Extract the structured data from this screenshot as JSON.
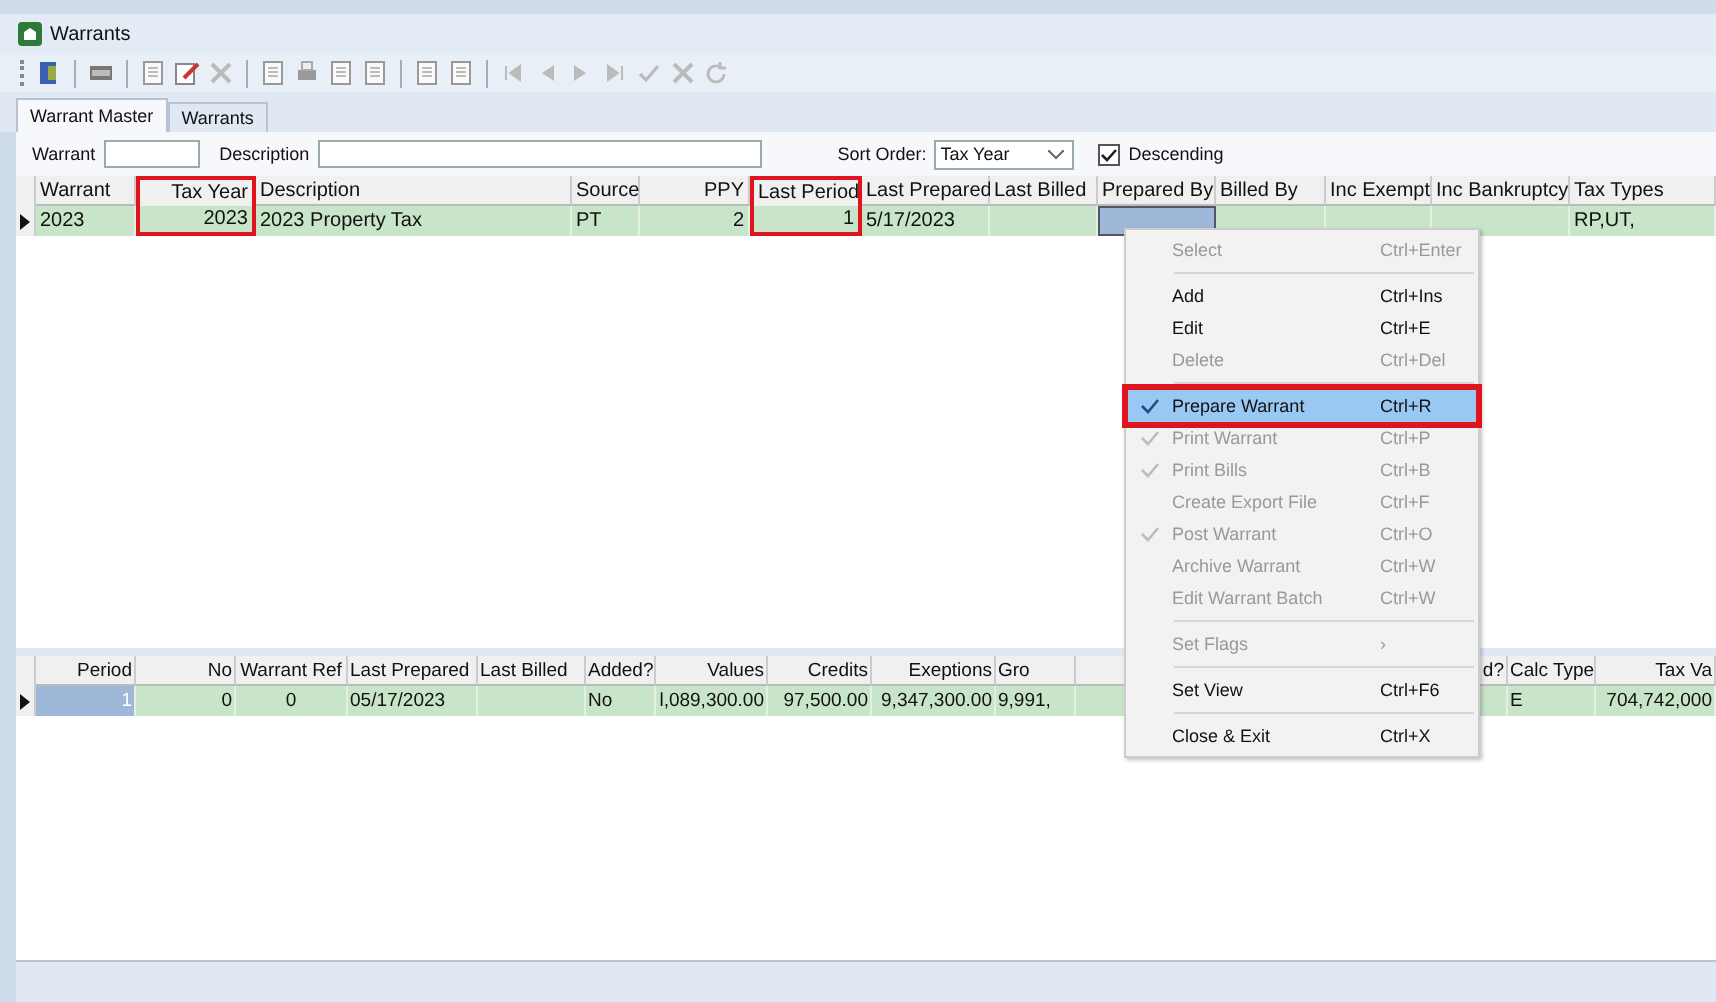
{
  "window": {
    "title": "Warrants"
  },
  "tabs": [
    {
      "label": "Warrant Master",
      "selected": true
    },
    {
      "label": "Warrants",
      "selected": false
    }
  ],
  "filter": {
    "warrant_label": "Warrant",
    "description_label": "Description",
    "sort_label": "Sort Order:",
    "sort_value": "Tax Year",
    "descending": {
      "label": "Descending",
      "checked": true
    }
  },
  "master_grid": {
    "columns": [
      {
        "label": "Warrant",
        "highlighted": false
      },
      {
        "label": "Tax Year",
        "highlighted": true
      },
      {
        "label": "Description",
        "highlighted": false
      },
      {
        "label": "Source",
        "highlighted": false
      },
      {
        "label": "PPY",
        "highlighted": false
      },
      {
        "label": "Last Period",
        "highlighted": true
      },
      {
        "label": "Last Prepared",
        "highlighted": false
      },
      {
        "label": "Last Billed",
        "highlighted": false
      },
      {
        "label": "Prepared By",
        "highlighted": false
      },
      {
        "label": "Billed By",
        "highlighted": false
      },
      {
        "label": "Inc Exempt",
        "highlighted": false
      },
      {
        "label": "Inc Bankruptcy",
        "highlighted": false
      },
      {
        "label": "Tax Types",
        "highlighted": false
      }
    ],
    "rows": [
      {
        "current": true,
        "cells": [
          {
            "text": "2023",
            "selected": false
          },
          {
            "text": "2023",
            "selected": false
          },
          {
            "text": "2023 Property Tax",
            "selected": false
          },
          {
            "text": "PT",
            "selected": false
          },
          {
            "text": "2",
            "selected": false
          },
          {
            "text": "1",
            "selected": false
          },
          {
            "text": "5/17/2023",
            "selected": false
          },
          {
            "text": "",
            "selected": false
          },
          {
            "text": "",
            "selected": true
          },
          {
            "text": "",
            "selected": false
          },
          {
            "text": "",
            "selected": false
          },
          {
            "text": "",
            "selected": false
          },
          {
            "text": "RP,UT,",
            "selected": false
          }
        ]
      }
    ]
  },
  "detail_grid": {
    "columns": [
      {
        "label": "Period",
        "highlighted": false
      },
      {
        "label": "No",
        "highlighted": false
      },
      {
        "label": "Warrant Ref",
        "highlighted": false
      },
      {
        "label": "Last Prepared",
        "highlighted": false
      },
      {
        "label": "Last Billed",
        "highlighted": false
      },
      {
        "label": "Added?",
        "highlighted": false
      },
      {
        "label": "Values",
        "highlighted": false
      },
      {
        "label": "Credits",
        "highlighted": false
      },
      {
        "label": "Exeptions",
        "highlighted": false
      },
      {
        "label": "Gro",
        "highlighted": false
      },
      {
        "label": "d?",
        "highlighted": false
      },
      {
        "label": "Calc Type",
        "highlighted": false
      },
      {
        "label": "Tax Va",
        "highlighted": false
      }
    ],
    "rows": [
      {
        "current": true,
        "cells": [
          {
            "text": "1",
            "selected": true
          },
          {
            "text": "0",
            "selected": false
          },
          {
            "text": "0",
            "selected": false
          },
          {
            "text": "05/17/2023",
            "selected": false
          },
          {
            "text": "",
            "selected": false
          },
          {
            "text": "No",
            "selected": false
          },
          {
            "text": "l,089,300.00",
            "selected": false
          },
          {
            "text": "97,500.00",
            "selected": false
          },
          {
            "text": "9,347,300.00",
            "selected": false
          },
          {
            "text": "9,991,",
            "selected": false
          },
          {
            "text": "",
            "selected": false
          },
          {
            "text": "E",
            "selected": false
          },
          {
            "text": "704,742,000",
            "selected": false
          }
        ]
      }
    ]
  },
  "context_menu": {
    "items": [
      {
        "kind": "item",
        "label": "Select",
        "shortcut": "Ctrl+Enter",
        "disabled": true,
        "checked": false,
        "selected": false,
        "highlighted": false
      },
      {
        "kind": "separator"
      },
      {
        "kind": "item",
        "label": "Add",
        "shortcut": "Ctrl+Ins",
        "disabled": false,
        "checked": false,
        "selected": false,
        "highlighted": false
      },
      {
        "kind": "item",
        "label": "Edit",
        "shortcut": "Ctrl+E",
        "disabled": false,
        "checked": false,
        "selected": false,
        "highlighted": false
      },
      {
        "kind": "item",
        "label": "Delete",
        "shortcut": "Ctrl+Del",
        "disabled": true,
        "checked": false,
        "selected": false,
        "highlighted": false
      },
      {
        "kind": "separator"
      },
      {
        "kind": "item",
        "label": "Prepare Warrant",
        "shortcut": "Ctrl+R",
        "disabled": false,
        "checked": true,
        "selected": true,
        "highlighted": true
      },
      {
        "kind": "item",
        "label": "Print Warrant",
        "shortcut": "Ctrl+P",
        "disabled": true,
        "checked": true,
        "selected": false,
        "highlighted": false
      },
      {
        "kind": "item",
        "label": "Print Bills",
        "shortcut": "Ctrl+B",
        "disabled": true,
        "checked": true,
        "selected": false,
        "highlighted": false
      },
      {
        "kind": "item",
        "label": "Create Export File",
        "shortcut": "Ctrl+F",
        "disabled": true,
        "checked": false,
        "selected": false,
        "highlighted": false
      },
      {
        "kind": "item",
        "label": "Post Warrant",
        "shortcut": "Ctrl+O",
        "disabled": true,
        "checked": true,
        "selected": false,
        "highlighted": false
      },
      {
        "kind": "item",
        "label": "Archive Warrant",
        "shortcut": "Ctrl+W",
        "disabled": true,
        "checked": false,
        "selected": false,
        "highlighted": false
      },
      {
        "kind": "item",
        "label": "Edit Warrant Batch",
        "shortcut": "Ctrl+W",
        "disabled": true,
        "checked": false,
        "selected": false,
        "highlighted": false
      },
      {
        "kind": "separator"
      },
      {
        "kind": "submenu",
        "label": "Set Flags",
        "shortcut": "›",
        "disabled": true,
        "checked": false,
        "selected": false,
        "highlighted": false
      },
      {
        "kind": "separator"
      },
      {
        "kind": "item",
        "label": "Set View",
        "shortcut": "Ctrl+F6",
        "disabled": false,
        "checked": false,
        "selected": false,
        "highlighted": false
      },
      {
        "kind": "separator"
      },
      {
        "kind": "item",
        "label": "Close & Exit",
        "shortcut": "Ctrl+X",
        "disabled": false,
        "checked": false,
        "selected": false,
        "highlighted": false
      }
    ]
  }
}
